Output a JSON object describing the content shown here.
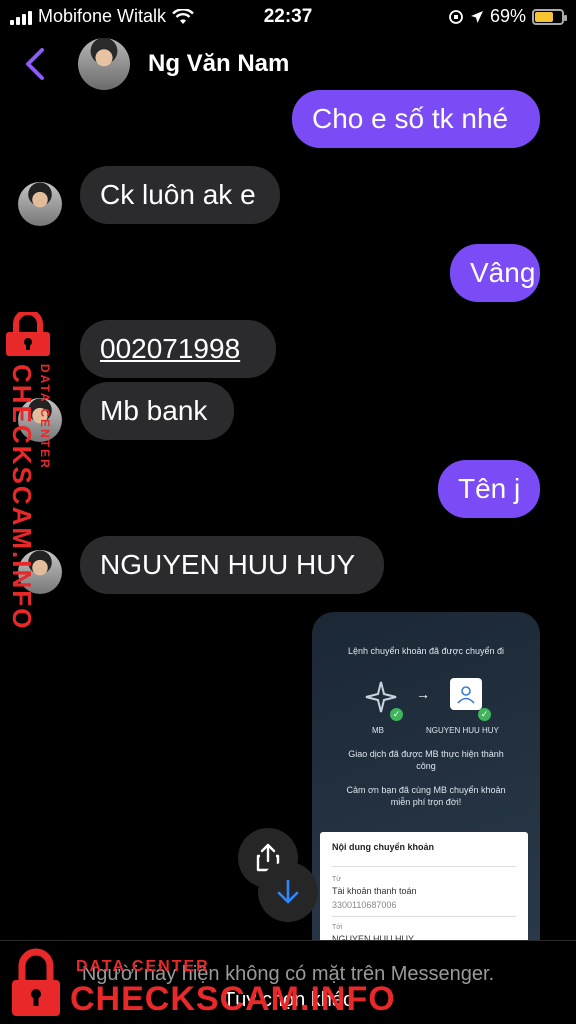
{
  "status_bar": {
    "carrier": "Mobifone Witalk",
    "time": "22:37",
    "battery": "69%",
    "battery_level": 0.69
  },
  "header": {
    "name": "Ng Văn Nam"
  },
  "messages": [
    {
      "dir": "out",
      "text": "Cho e số tk nhé"
    },
    {
      "dir": "in",
      "text": "Ck luôn ak e"
    },
    {
      "dir": "out",
      "text": "Vâng"
    },
    {
      "dir": "in",
      "text": "002071998"
    },
    {
      "dir": "in",
      "text": "Mb bank"
    },
    {
      "dir": "out",
      "text": "Tên j"
    },
    {
      "dir": "in",
      "text": "NGUYEN HUU HUY"
    }
  ],
  "receipt": {
    "title": "Lệnh chuyển khoản đã được chuyển đi",
    "from_label": "MB",
    "to_label": "NGUYEN HUU HUY",
    "success_text": "Giao dịch đã được MB thực hiện thành công",
    "thanks_text": "Cảm ơn bạn đã cùng MB chuyển khoản miễn phí trọn đời!",
    "card_title": "Nội dung chuyển khoản",
    "from_small": "Từ",
    "from_value": "Tài khoản thanh toán",
    "account_no": "3300110687006",
    "to_small": "Tới",
    "to_value": "NGUYEN HUU HUY"
  },
  "bottom": {
    "notice": "Người này hiện không có mặt trên Messenger.",
    "action": "Tùy chọn khác"
  },
  "watermark": {
    "main": "CHECKSCAM.INFO",
    "sub": "DATA CENTER"
  },
  "colors": {
    "outgoing_bubble": "#7b4cf5",
    "incoming_bubble": "#2b2b2d",
    "watermark": "#e9282a"
  }
}
